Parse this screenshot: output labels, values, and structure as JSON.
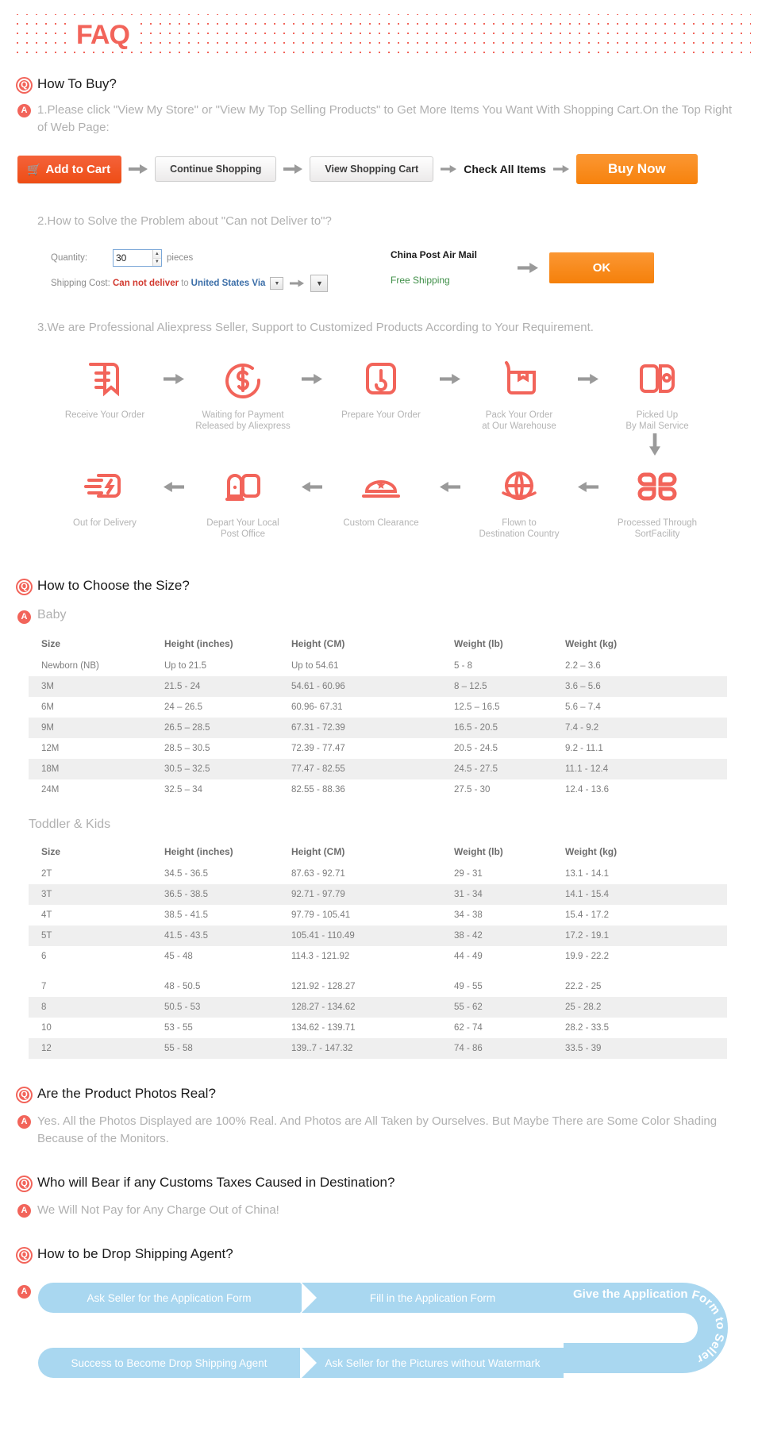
{
  "header": {
    "title": "FAQ"
  },
  "markers": {
    "q": "Q",
    "a": "A"
  },
  "section1": {
    "question": "How To Buy?",
    "answer1": "1.Please click \"View My Store\" or \"View My Top Selling Products\" to Get More Items You Want With Shopping Cart.On the Top Right of Web Page:",
    "buttons": {
      "add_to_cart": "Add to Cart",
      "continue_shopping": "Continue Shopping",
      "view_shopping_cart": "View Shopping Cart",
      "check_all_items": "Check All Items",
      "buy_now": "Buy Now"
    },
    "answer2": "2.How to Solve the Problem about \"Can not Deliver to\"?",
    "shipping_widget": {
      "quantity_label": "Quantity:",
      "quantity_value": "30",
      "pieces_label": "pieces",
      "shipping_cost_label": "Shipping Cost:",
      "cannot_deliver": "Can not deliver",
      "to_word": "to",
      "country": "United States Via",
      "carrier": "China Post Air Mail",
      "free_shipping": "Free Shipping",
      "ok_button": "OK"
    },
    "answer3": "3.We are Professional Aliexpress Seller, Support to Customized Products According to Your Requirement.",
    "process_row1": [
      {
        "icon": "document-order-icon",
        "label": "Receive Your Order"
      },
      {
        "icon": "dollar-payment-icon",
        "label": "Waiting for Payment\nReleased by Aliexpress"
      },
      {
        "icon": "prepare-order-icon",
        "label": "Prepare Your Order"
      },
      {
        "icon": "pack-box-icon",
        "label": "Pack Your Order\nat Our Warehouse"
      },
      {
        "icon": "picked-up-mail-icon",
        "label": "Picked Up\nBy Mail Service"
      }
    ],
    "process_row2": [
      {
        "icon": "out-for-delivery-icon",
        "label": "Out for Delivery"
      },
      {
        "icon": "post-office-icon",
        "label": "Depart Your Local\nPost Office"
      },
      {
        "icon": "custom-clearance-icon",
        "label": "Custom Clearance"
      },
      {
        "icon": "flown-globe-icon",
        "label": "Flown to\nDestination Country"
      },
      {
        "icon": "sort-facility-icon",
        "label": "Processed Through\nSortFacility"
      }
    ]
  },
  "section2": {
    "question": "How to Choose the Size?",
    "baby_heading": "Baby",
    "toddler_heading": "Toddler & Kids",
    "columns": [
      "Size",
      "Height (inches)",
      "Height (CM)",
      "Weight (lb)",
      "Weight (kg)"
    ],
    "baby_rows": [
      [
        "Newborn (NB)",
        "Up to 21.5",
        "Up to 54.61",
        "5 - 8",
        "2.2 – 3.6"
      ],
      [
        "3M",
        "21.5 - 24",
        "54.61 - 60.96",
        "8 – 12.5",
        "3.6 – 5.6"
      ],
      [
        "6M",
        "24 – 26.5",
        "60.96- 67.31",
        "12.5 – 16.5",
        "5.6 – 7.4"
      ],
      [
        "9M",
        "26.5 – 28.5",
        "67.31 - 72.39",
        "16.5 - 20.5",
        "7.4 - 9.2"
      ],
      [
        "12M",
        "28.5 – 30.5",
        "72.39 - 77.47",
        "20.5 - 24.5",
        "9.2 - 11.1"
      ],
      [
        "18M",
        "30.5 – 32.5",
        "77.47 - 82.55",
        "24.5 - 27.5",
        "11.1 - 12.4"
      ],
      [
        "24M",
        "32.5 – 34",
        "82.55 - 88.36",
        "27.5 - 30",
        "12.4 - 13.6"
      ]
    ],
    "toddler_rows": [
      [
        "2T",
        "34.5 - 36.5",
        "87.63 - 92.71",
        "29 - 31",
        "13.1 - 14.1"
      ],
      [
        "3T",
        "36.5 - 38.5",
        "92.71 - 97.79",
        "31 - 34",
        "14.1 - 15.4"
      ],
      [
        "4T",
        "38.5 - 41.5",
        "97.79 - 105.41",
        "34 - 38",
        "15.4 - 17.2"
      ],
      [
        "5T",
        "41.5 - 43.5",
        "105.41 - 110.49",
        "38 - 42",
        "17.2 - 19.1"
      ],
      [
        "6",
        "45 - 48",
        "114.3 - 121.92",
        "44 - 49",
        "19.9 - 22.2"
      ],
      [
        "",
        "",
        "",
        "",
        ""
      ],
      [
        "7",
        "48 - 50.5",
        "121.92 - 128.27",
        "49 - 55",
        "22.2 - 25"
      ],
      [
        "8",
        "50.5 - 53",
        "128.27 - 134.62",
        "55 - 62",
        "25 - 28.2"
      ],
      [
        "10",
        "53 - 55",
        "134.62 - 139.71",
        "62 - 74",
        "28.2 - 33.5"
      ],
      [
        "12",
        "55 - 58",
        "139..7 - 147.32",
        "74 - 86",
        "33.5 - 39"
      ]
    ]
  },
  "section3": {
    "question": "Are the Product Photos Real?",
    "answer": "Yes. All the Photos Displayed are 100% Real. And Photos are All Taken by Ourselves. But Maybe There are Some Color Shading Because of the Monitors."
  },
  "section4": {
    "question": "Who will Bear if any Customs Taxes Caused in Destination?",
    "answer": "We Will Not Pay for Any Charge Out of China!"
  },
  "section5": {
    "question": "How to be Drop Shipping Agent?",
    "steps_top": [
      "Ask Seller for the Application Form",
      "Fill in the Application Form"
    ],
    "curve_label": "Give the Application Form to Seller",
    "steps_bottom": [
      "Success to Become Drop Shipping Agent",
      "Ask Seller for the Pictures without Watermark"
    ]
  },
  "colors": {
    "accent_red": "#f2645a",
    "orange_cart": "#ee4d15",
    "orange_buy": "#f7820c",
    "blue_chevron": "#a9d7f0",
    "green_free": "#3f8f48",
    "table_alt": "#efefef"
  }
}
